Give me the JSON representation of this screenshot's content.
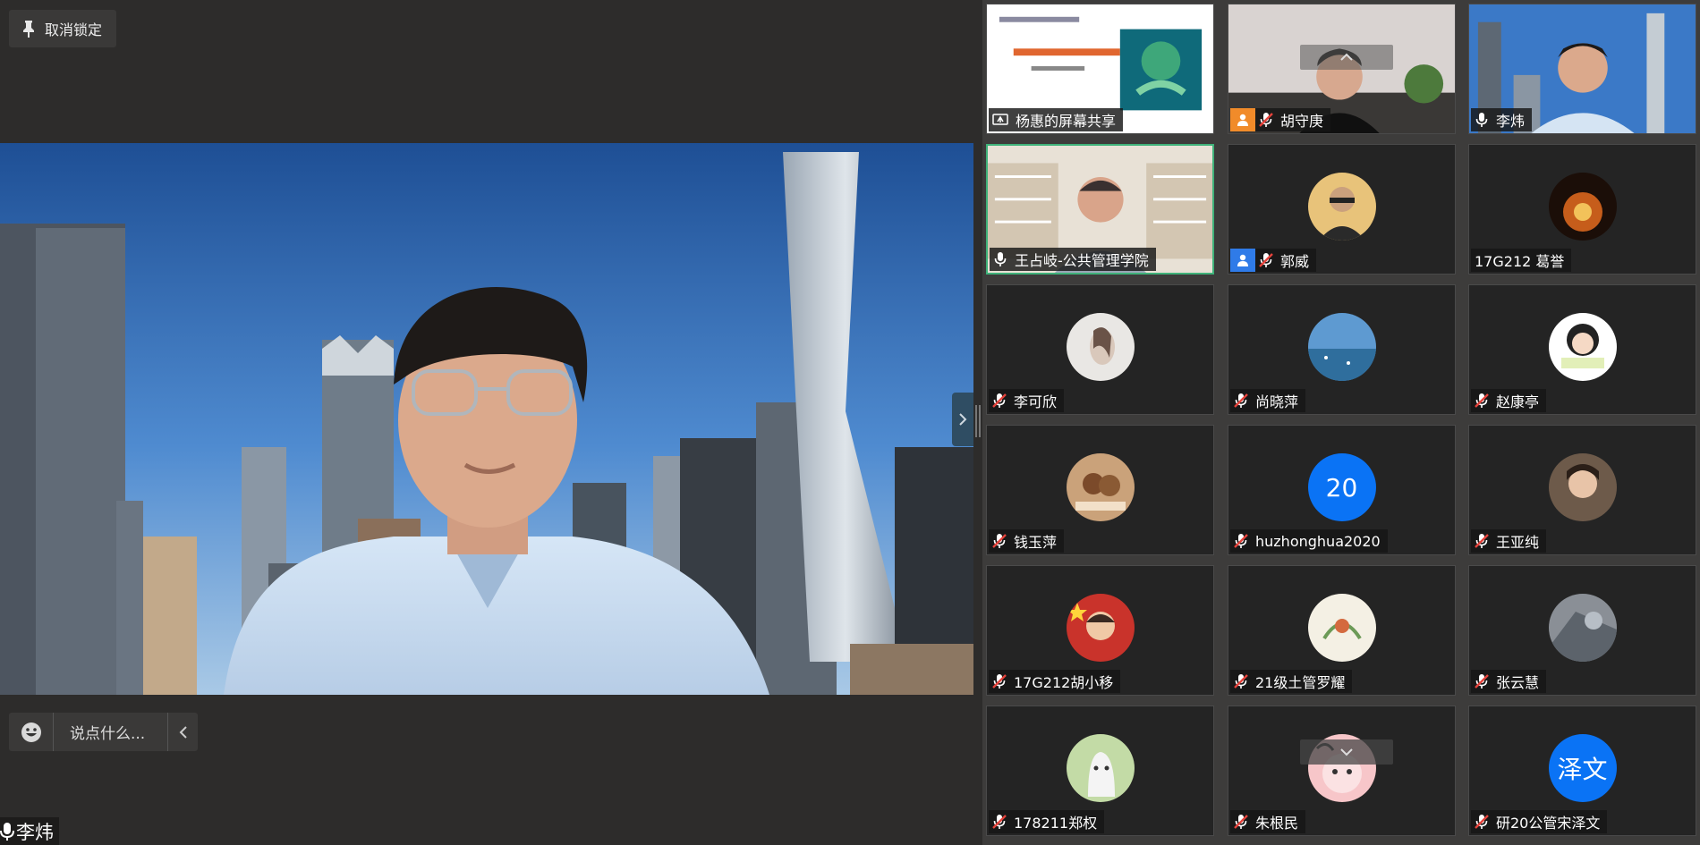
{
  "stage": {
    "unlock_label": "取消锁定",
    "chat_placeholder": "说点什么...",
    "speaker_name": "李炜"
  },
  "colors": {
    "active_border": "#3fb27a",
    "host_orange": "#f18b2a",
    "cohost_blue": "#2f7be8",
    "mic_muted_red": "#e5433c",
    "badge_blue": "#0a73f5"
  },
  "tiles": [
    {
      "name": "杨惠的屏幕共享",
      "kind": "screen-share"
    },
    {
      "name": "胡守庚",
      "kind": "video",
      "role": "host",
      "mic": "muted"
    },
    {
      "name": "李炜",
      "kind": "video",
      "mic": "on"
    },
    {
      "name": "王占岐-公共管理学院",
      "kind": "video",
      "mic": "on",
      "active": true
    },
    {
      "name": "郭威",
      "kind": "avatar",
      "role": "cohost",
      "mic": "muted"
    },
    {
      "name": "17G212 葛誉",
      "kind": "avatar",
      "mic": "none"
    },
    {
      "name": "李可欣",
      "kind": "avatar",
      "mic": "muted"
    },
    {
      "name": "尚晓萍",
      "kind": "avatar",
      "mic": "muted"
    },
    {
      "name": "赵康亭",
      "kind": "avatar",
      "mic": "muted"
    },
    {
      "name": "钱玉萍",
      "kind": "avatar",
      "mic": "muted"
    },
    {
      "name": "huzhonghua2020",
      "kind": "text-avatar",
      "initials": "20",
      "mic": "muted"
    },
    {
      "name": "王亚纯",
      "kind": "avatar",
      "mic": "muted"
    },
    {
      "name": "17G212胡小移",
      "kind": "avatar",
      "mic": "muted"
    },
    {
      "name": "21级土管罗耀",
      "kind": "avatar",
      "mic": "muted"
    },
    {
      "name": "张云慧",
      "kind": "avatar",
      "mic": "muted"
    },
    {
      "name": "178211郑权",
      "kind": "avatar",
      "mic": "muted"
    },
    {
      "name": "朱根民",
      "kind": "avatar",
      "mic": "muted"
    },
    {
      "name": "研20公管宋泽文",
      "kind": "text-avatar",
      "initials": "泽文",
      "mic": "muted"
    }
  ]
}
